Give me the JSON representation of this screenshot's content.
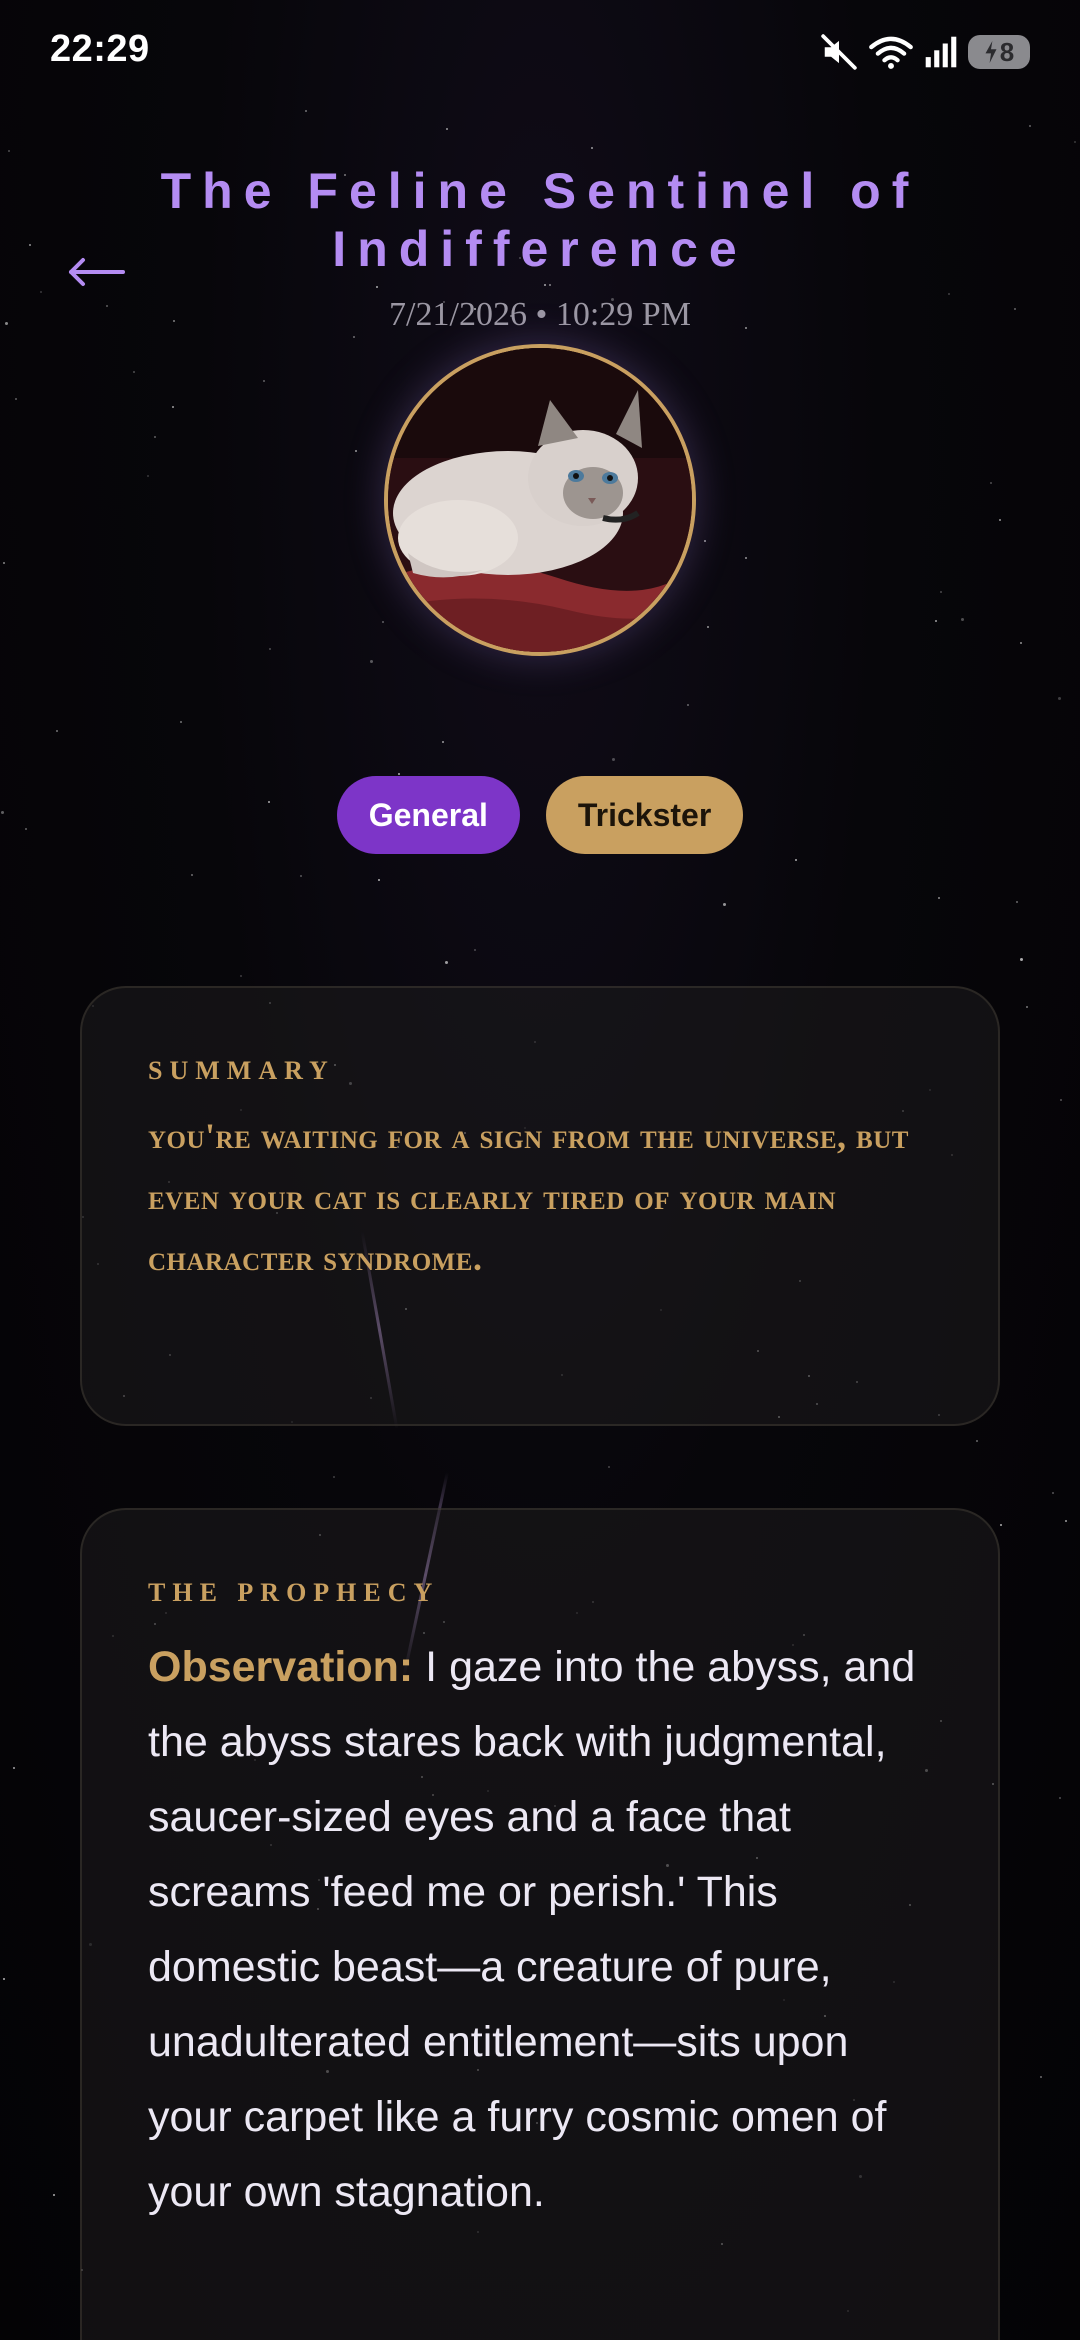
{
  "status_bar": {
    "time": "22:29",
    "battery_level": "8",
    "icons": [
      "mute-icon",
      "wifi-icon",
      "signal-icon",
      "battery-charging-icon"
    ]
  },
  "header": {
    "back_icon": "arrow-left-icon",
    "title": "The Feline Sentinel of Indifference",
    "date": "7/21/2026 • 10:29 PM"
  },
  "avatar": {
    "subject": "cat photo"
  },
  "tags": [
    {
      "label": "General",
      "color": "#7d35c8"
    },
    {
      "label": "Trickster",
      "color": "#c9a060"
    }
  ],
  "summary": {
    "label": "SUMMARY",
    "text": "You're waiting for a sign from the universe, but even your cat is clearly tired of your main character syndrome."
  },
  "prophecy": {
    "label": "THE PROPHECY",
    "lead": "Observation:",
    "text": " I gaze into the abyss, and the abyss stares back with judgmental, saucer-sized eyes and a face that screams 'feed me or perish.' This domestic beast—a creature of pure, unadulterated entitlement—sits upon your carpet like a furry cosmic omen of your own stagnation."
  },
  "colors": {
    "accent_purple": "#b48cf2",
    "accent_gold": "#c9a060",
    "background": "#050407"
  }
}
